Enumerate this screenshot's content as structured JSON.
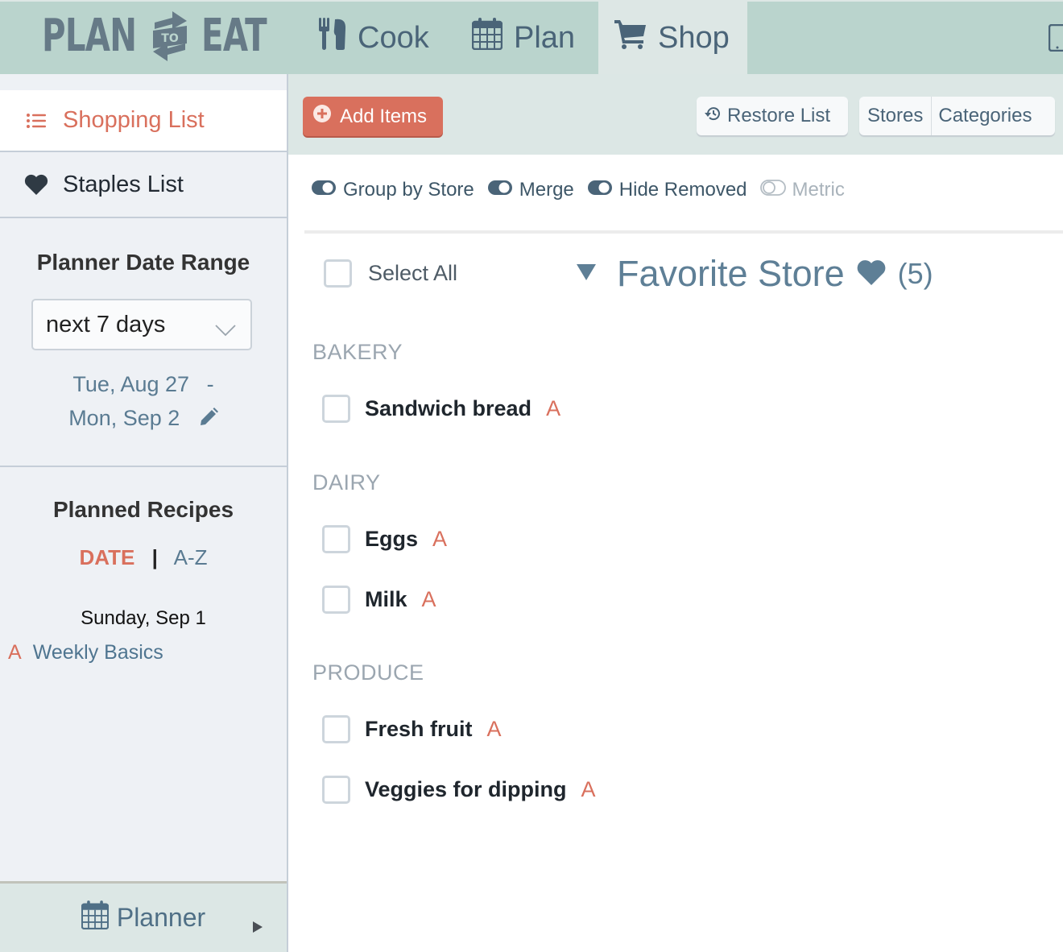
{
  "app": {
    "logo": {
      "left": "PLAN",
      "middle": "TO",
      "right": "EAT"
    },
    "nav": [
      {
        "label": "Cook",
        "icon": "utensils-icon",
        "active": false
      },
      {
        "label": "Plan",
        "icon": "calendar-icon",
        "active": false
      },
      {
        "label": "Shop",
        "icon": "cart-icon",
        "active": true
      }
    ],
    "device_icon": "mobile-device-icon"
  },
  "sidebar": {
    "items": [
      {
        "label": "Shopping List",
        "icon": "list-icon",
        "active": true
      },
      {
        "label": "Staples List",
        "icon": "heart-icon",
        "active": false
      }
    ],
    "date_range": {
      "title": "Planner Date Range",
      "selected": "next 7 days",
      "start": "Tue, Aug 27",
      "separator": "-",
      "end": "Mon, Sep 2",
      "edit_icon": "pencil-icon"
    },
    "planned_recipes": {
      "title": "Planned Recipes",
      "sort_date": "DATE",
      "sort_sep": "|",
      "sort_az": "A-Z",
      "days": [
        {
          "label": "Sunday, Sep 1",
          "recipes": [
            {
              "tag": "A",
              "name": "Weekly Basics"
            }
          ]
        }
      ]
    },
    "planner_button": "Planner"
  },
  "toolbar": {
    "add_items": "Add Items",
    "restore_list": "Restore List",
    "stores": "Stores",
    "categories": "Categories"
  },
  "toggles": [
    {
      "label": "Group by Store",
      "on": true
    },
    {
      "label": "Merge",
      "on": true
    },
    {
      "label": "Hide Removed",
      "on": true
    },
    {
      "label": "Metric",
      "on": false
    }
  ],
  "list": {
    "select_all": "Select All",
    "store": {
      "name": "Favorite Store",
      "count": "(5)"
    },
    "categories": [
      {
        "name": "BAKERY",
        "items": [
          {
            "name": "Sandwich bread",
            "tag": "A"
          }
        ]
      },
      {
        "name": "DAIRY",
        "items": [
          {
            "name": "Eggs",
            "tag": "A"
          },
          {
            "name": "Milk",
            "tag": "A"
          }
        ]
      },
      {
        "name": "PRODUCE",
        "items": [
          {
            "name": "Fresh fruit",
            "tag": "A"
          },
          {
            "name": "Veggies for dipping",
            "tag": "A"
          }
        ]
      }
    ]
  },
  "colors": {
    "accent": "#d9705d",
    "nav_bg": "#bad4cd",
    "nav_active_bg": "#dde7e5",
    "text_blue": "#4a6478"
  }
}
